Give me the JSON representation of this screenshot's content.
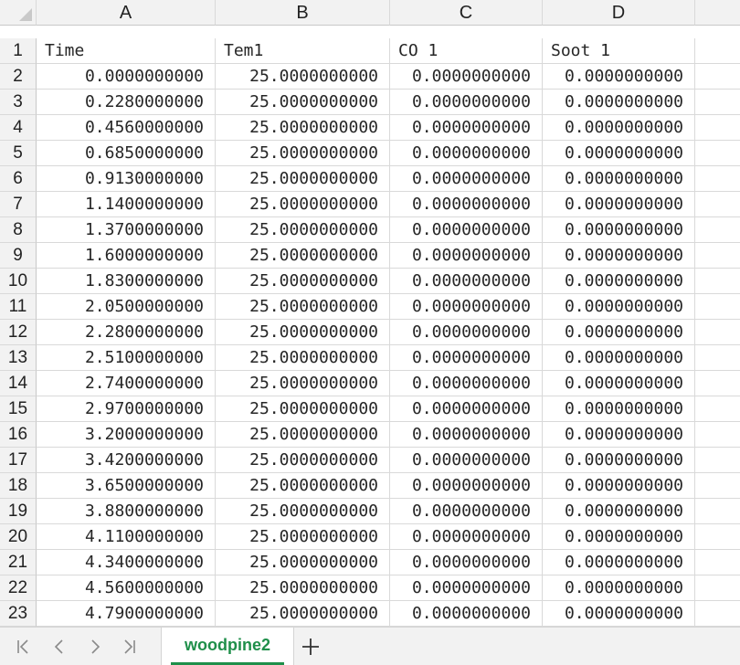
{
  "columns": [
    "A",
    "B",
    "C",
    "D"
  ],
  "headers": [
    "Time",
    "Tem1",
    "CO 1",
    "Soot 1"
  ],
  "rows": [
    {
      "n": "2",
      "a": "0.0000000000",
      "b": "25.0000000000",
      "c": "0.0000000000",
      "d": "0.0000000000"
    },
    {
      "n": "3",
      "a": "0.2280000000",
      "b": "25.0000000000",
      "c": "0.0000000000",
      "d": "0.0000000000"
    },
    {
      "n": "4",
      "a": "0.4560000000",
      "b": "25.0000000000",
      "c": "0.0000000000",
      "d": "0.0000000000"
    },
    {
      "n": "5",
      "a": "0.6850000000",
      "b": "25.0000000000",
      "c": "0.0000000000",
      "d": "0.0000000000"
    },
    {
      "n": "6",
      "a": "0.9130000000",
      "b": "25.0000000000",
      "c": "0.0000000000",
      "d": "0.0000000000"
    },
    {
      "n": "7",
      "a": "1.1400000000",
      "b": "25.0000000000",
      "c": "0.0000000000",
      "d": "0.0000000000"
    },
    {
      "n": "8",
      "a": "1.3700000000",
      "b": "25.0000000000",
      "c": "0.0000000000",
      "d": "0.0000000000"
    },
    {
      "n": "9",
      "a": "1.6000000000",
      "b": "25.0000000000",
      "c": "0.0000000000",
      "d": "0.0000000000"
    },
    {
      "n": "10",
      "a": "1.8300000000",
      "b": "25.0000000000",
      "c": "0.0000000000",
      "d": "0.0000000000"
    },
    {
      "n": "11",
      "a": "2.0500000000",
      "b": "25.0000000000",
      "c": "0.0000000000",
      "d": "0.0000000000"
    },
    {
      "n": "12",
      "a": "2.2800000000",
      "b": "25.0000000000",
      "c": "0.0000000000",
      "d": "0.0000000000"
    },
    {
      "n": "13",
      "a": "2.5100000000",
      "b": "25.0000000000",
      "c": "0.0000000000",
      "d": "0.0000000000"
    },
    {
      "n": "14",
      "a": "2.7400000000",
      "b": "25.0000000000",
      "c": "0.0000000000",
      "d": "0.0000000000"
    },
    {
      "n": "15",
      "a": "2.9700000000",
      "b": "25.0000000000",
      "c": "0.0000000000",
      "d": "0.0000000000"
    },
    {
      "n": "16",
      "a": "3.2000000000",
      "b": "25.0000000000",
      "c": "0.0000000000",
      "d": "0.0000000000"
    },
    {
      "n": "17",
      "a": "3.4200000000",
      "b": "25.0000000000",
      "c": "0.0000000000",
      "d": "0.0000000000"
    },
    {
      "n": "18",
      "a": "3.6500000000",
      "b": "25.0000000000",
      "c": "0.0000000000",
      "d": "0.0000000000"
    },
    {
      "n": "19",
      "a": "3.8800000000",
      "b": "25.0000000000",
      "c": "0.0000000000",
      "d": "0.0000000000"
    },
    {
      "n": "20",
      "a": "4.1100000000",
      "b": "25.0000000000",
      "c": "0.0000000000",
      "d": "0.0000000000"
    },
    {
      "n": "21",
      "a": "4.3400000000",
      "b": "25.0000000000",
      "c": "0.0000000000",
      "d": "0.0000000000"
    },
    {
      "n": "22",
      "a": "4.5600000000",
      "b": "25.0000000000",
      "c": "0.0000000000",
      "d": "0.0000000000"
    },
    {
      "n": "23",
      "a": "4.7900000000",
      "b": "25.0000000000",
      "c": "0.0000000000",
      "d": "0.0000000000"
    }
  ],
  "sheet_tab": "woodpine2",
  "icons": {
    "corner": "select-all-triangle-icon",
    "first": "first-sheet-icon",
    "prev": "previous-sheet-icon",
    "next": "next-sheet-icon",
    "last": "last-sheet-icon",
    "add": "add-sheet-icon"
  },
  "colors": {
    "tab_text": "#1f8f4a",
    "header_bg": "#f2f2f2",
    "grid_line": "#d9d9d9"
  }
}
